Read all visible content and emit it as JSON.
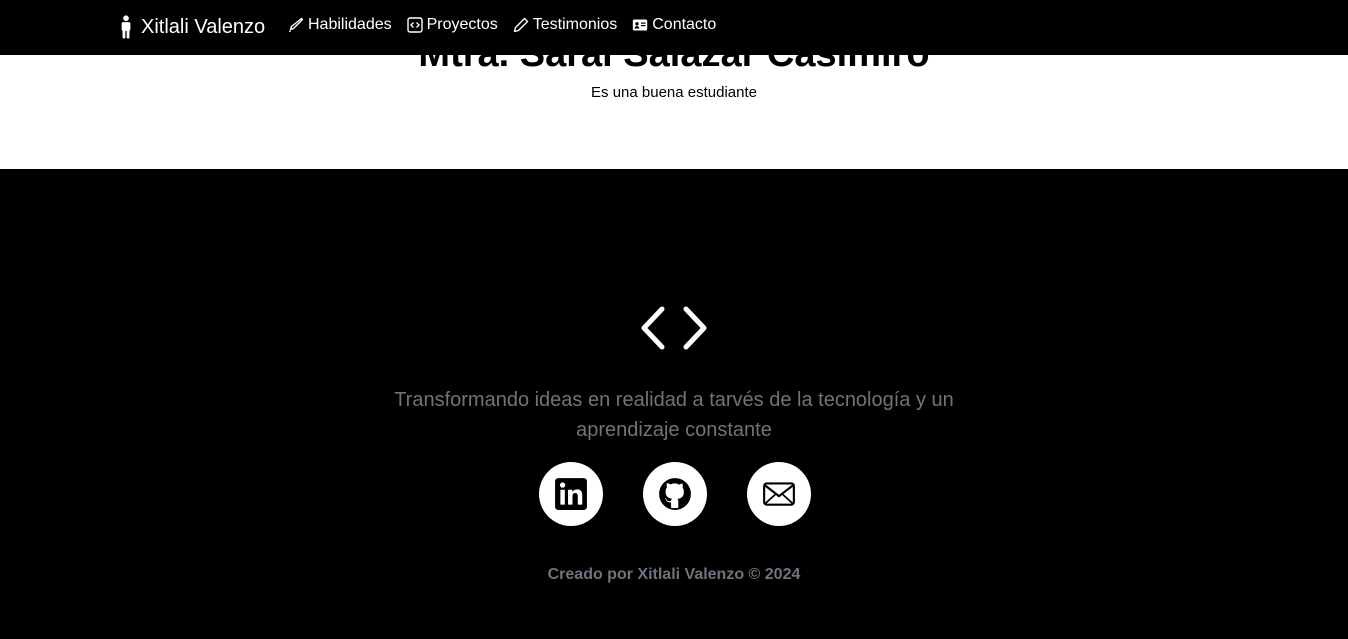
{
  "navbar": {
    "brand": "Xitlali Valenzo",
    "brand_icon": "person-standing-icon",
    "links": [
      {
        "label": "Habilidades",
        "icon": "pen-icon"
      },
      {
        "label": "Proyectos",
        "icon": "code-square-icon"
      },
      {
        "label": "Testimonios",
        "icon": "pencil-icon"
      },
      {
        "label": "Contacto",
        "icon": "person-vcard-icon"
      }
    ]
  },
  "testimonial": {
    "name": "Mtra. Sarai Salazar Casimiro",
    "text": "Es una buena estudiante"
  },
  "footer": {
    "logo_icon": "code-icon",
    "tagline": "Transformando ideas en realidad a tarvés de la tecnología y un aprendizaje constante",
    "socials": [
      {
        "name": "LinkedIn",
        "icon": "linkedin-icon"
      },
      {
        "name": "GitHub",
        "icon": "github-icon"
      },
      {
        "name": "Email",
        "icon": "envelope-icon"
      }
    ],
    "credit": "Creado por Xitlali Valenzo © 2024"
  },
  "colors": {
    "background": "#000000",
    "section_light": "#ffffff",
    "muted_text": "#6c757d"
  }
}
